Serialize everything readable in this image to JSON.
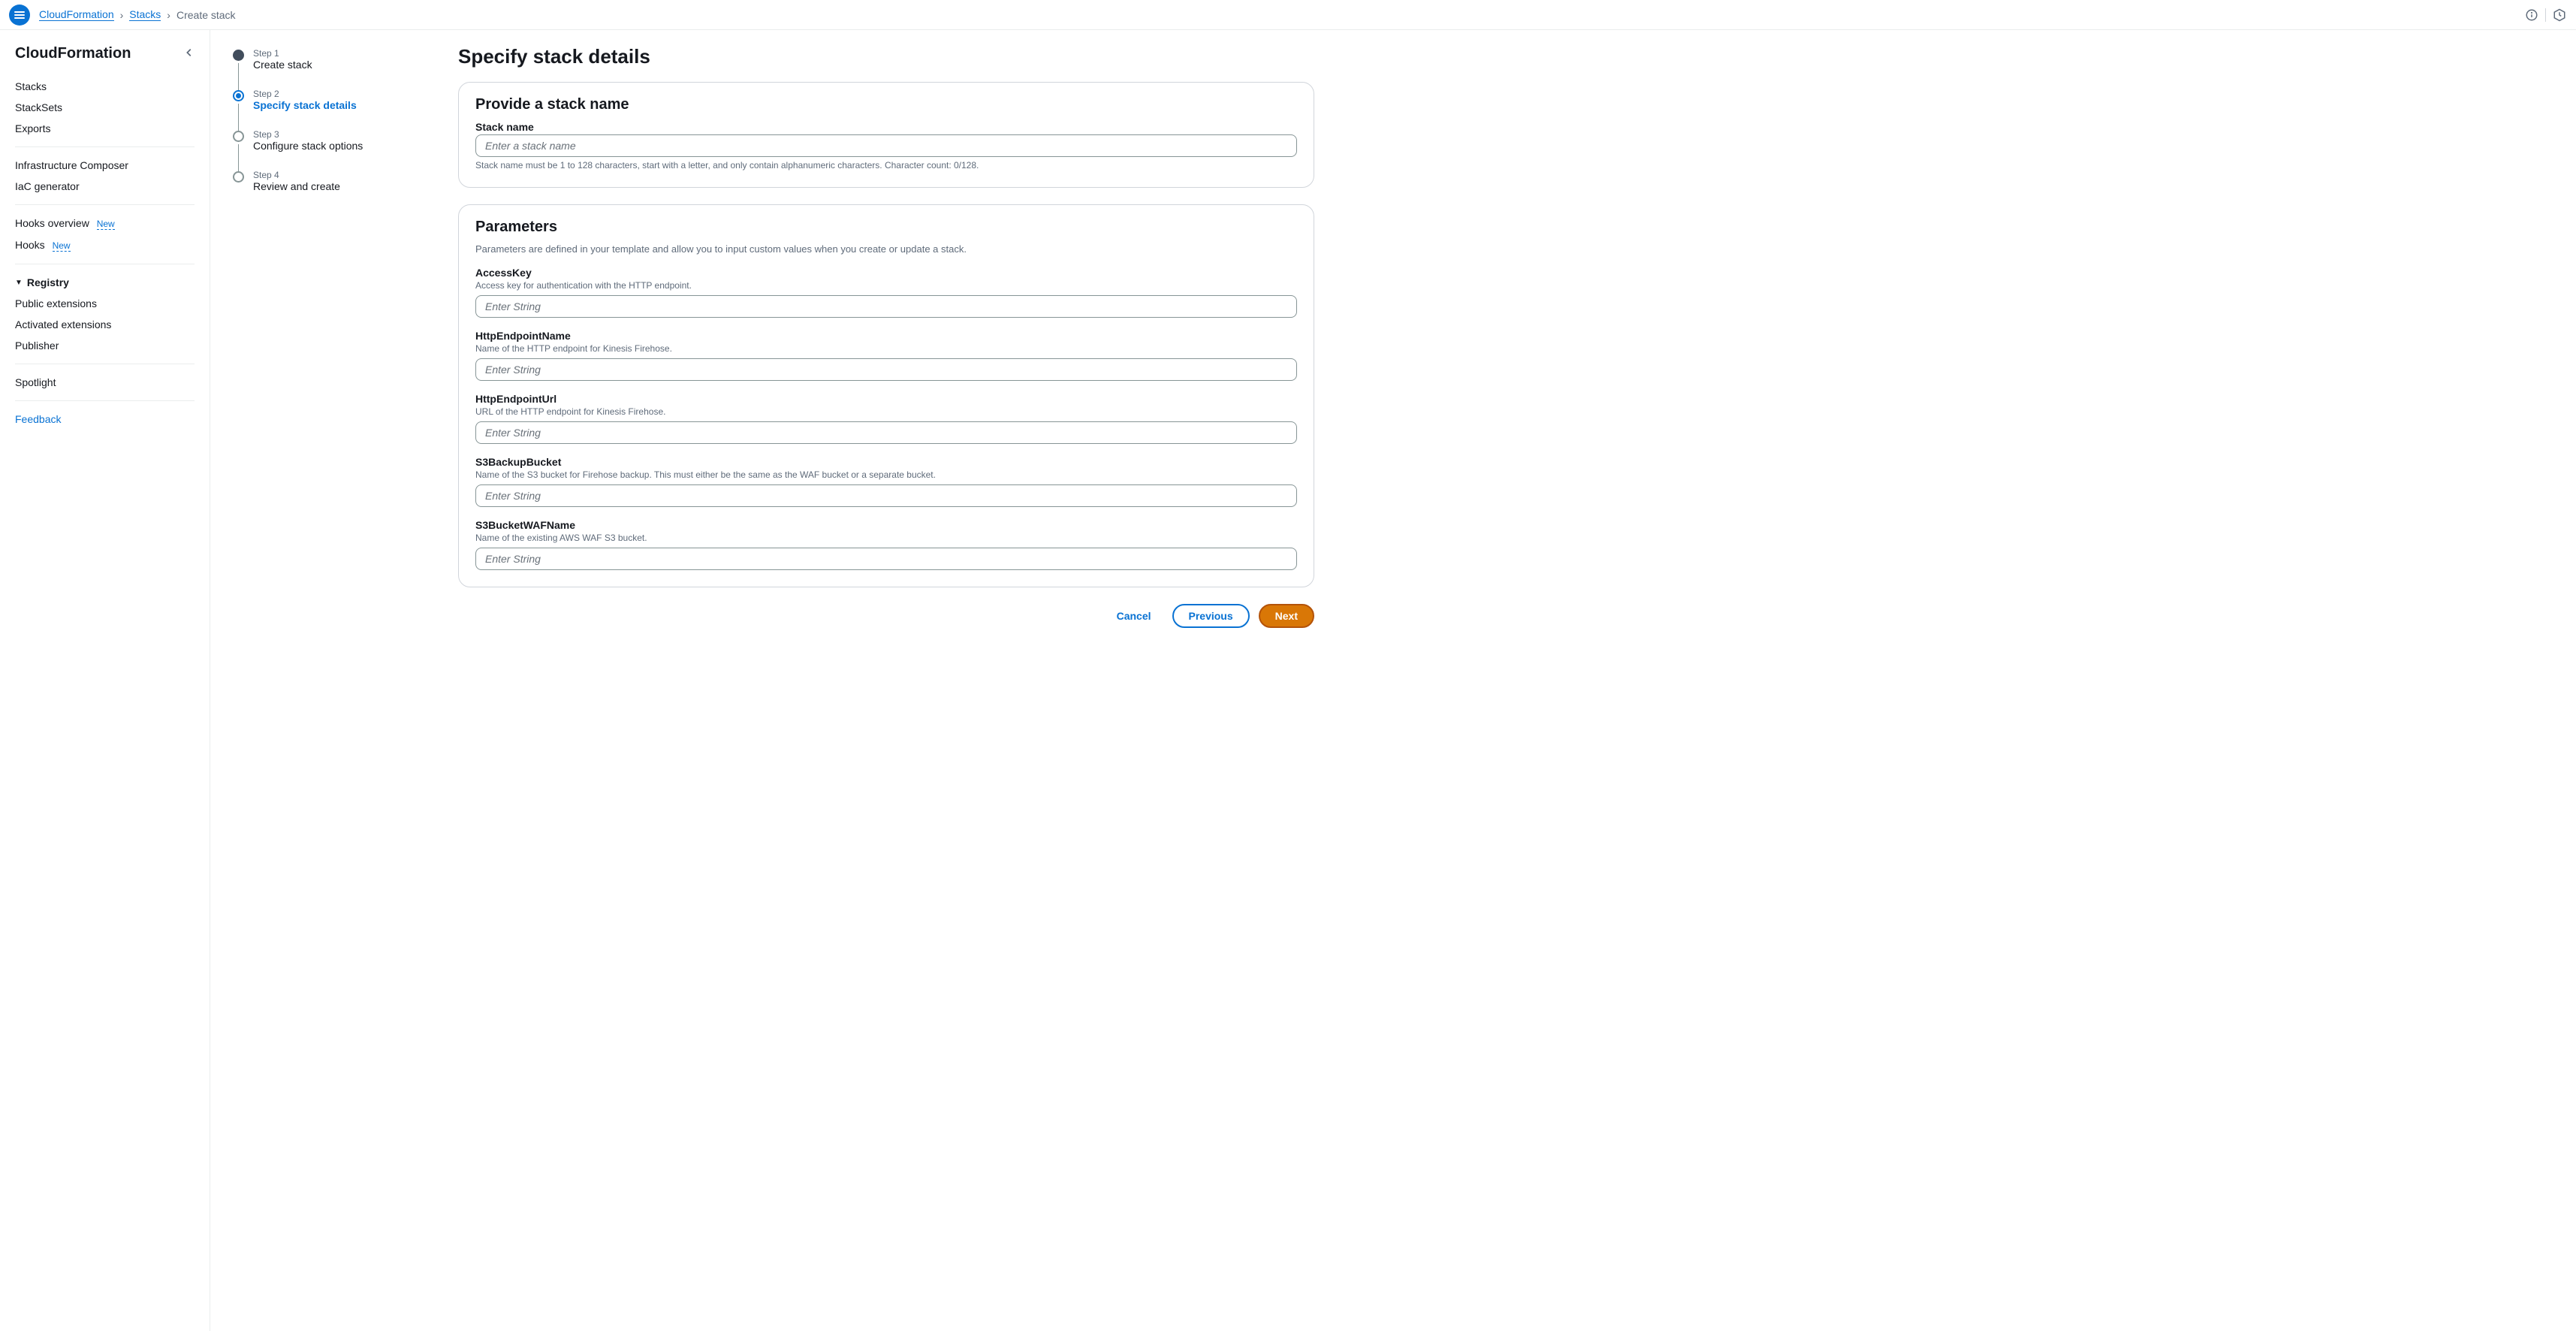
{
  "breadcrumb": {
    "service": "CloudFormation",
    "stacks": "Stacks",
    "current": "Create stack"
  },
  "sidebar": {
    "title": "CloudFormation",
    "items": {
      "stacks": "Stacks",
      "stacksets": "StackSets",
      "exports": "Exports",
      "infra_composer": "Infrastructure Composer",
      "iac_generator": "IaC generator",
      "hooks_overview": "Hooks overview",
      "hooks": "Hooks",
      "registry": "Registry",
      "public_ext": "Public extensions",
      "activated_ext": "Activated extensions",
      "publisher": "Publisher",
      "spotlight": "Spotlight",
      "feedback": "Feedback"
    },
    "badge_new": "New"
  },
  "wizard": {
    "step1_label": "Step 1",
    "step1_title": "Create stack",
    "step2_label": "Step 2",
    "step2_title": "Specify stack details",
    "step3_label": "Step 3",
    "step3_title": "Configure stack options",
    "step4_label": "Step 4",
    "step4_title": "Review and create"
  },
  "page": {
    "title": "Specify stack details"
  },
  "panel_stack": {
    "title": "Provide a stack name",
    "field_label": "Stack name",
    "placeholder": "Enter a stack name",
    "hint": "Stack name must be 1 to 128 characters, start with a letter, and only contain alphanumeric characters. Character count: 0/128."
  },
  "panel_params": {
    "title": "Parameters",
    "desc": "Parameters are defined in your template and allow you to input custom values when you create or update a stack.",
    "params": [
      {
        "label": "AccessKey",
        "hint": "Access key for authentication with the HTTP endpoint.",
        "placeholder": "Enter String"
      },
      {
        "label": "HttpEndpointName",
        "hint": "Name of the HTTP endpoint for Kinesis Firehose.",
        "placeholder": "Enter String"
      },
      {
        "label": "HttpEndpointUrl",
        "hint": "URL of the HTTP endpoint for Kinesis Firehose.",
        "placeholder": "Enter String"
      },
      {
        "label": "S3BackupBucket",
        "hint": "Name of the S3 bucket for Firehose backup. This must either be the same as the WAF bucket or a separate bucket.",
        "placeholder": "Enter String"
      },
      {
        "label": "S3BucketWAFName",
        "hint": "Name of the existing AWS WAF S3 bucket.",
        "placeholder": "Enter String"
      }
    ]
  },
  "buttons": {
    "cancel": "Cancel",
    "previous": "Previous",
    "next": "Next"
  }
}
